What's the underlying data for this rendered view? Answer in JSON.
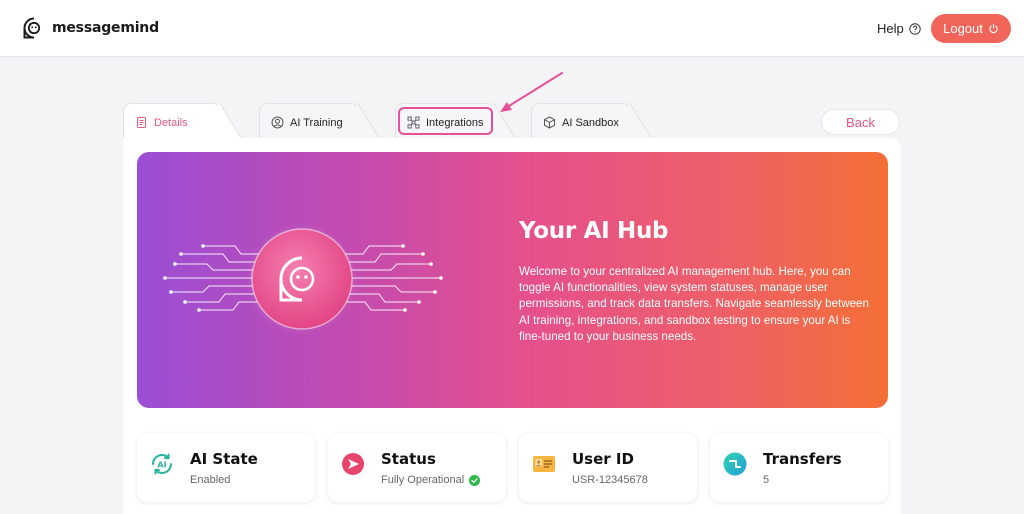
{
  "header": {
    "brand": "messagemind",
    "help_label": "Help",
    "logout_label": "Logout"
  },
  "tabs": [
    {
      "label": "Details",
      "icon": "document-icon",
      "active": true
    },
    {
      "label": "AI Training",
      "icon": "user-circle-icon",
      "active": false
    },
    {
      "label": "Integrations",
      "icon": "integrations-icon",
      "active": false,
      "highlighted": true
    },
    {
      "label": "AI Sandbox",
      "icon": "cube-icon",
      "active": false
    }
  ],
  "back_label": "Back",
  "hero": {
    "title": "Your AI Hub",
    "description": "Welcome to your centralized AI management hub. Here, you can toggle AI functionalities, view system statuses, manage user permissions, and track data transfers. Navigate seamlessly between AI training, integrations, and sandbox testing to ensure your AI is fine-tuned to your business needs."
  },
  "stats": [
    {
      "title": "AI State",
      "value": "Enabled",
      "icon": "ai-refresh-icon"
    },
    {
      "title": "Status",
      "value": "Fully Operational",
      "icon": "status-icon",
      "check": true
    },
    {
      "title": "User ID",
      "value": "USR-12345678",
      "icon": "id-card-icon"
    },
    {
      "title": "Transfers",
      "value": "5",
      "icon": "transfer-icon"
    }
  ],
  "colors": {
    "accent": "#e5577e",
    "logout": "#f0645a",
    "highlight": "#e4509a",
    "hero_start": "#9a4ed6",
    "hero_end": "#f56f36"
  }
}
